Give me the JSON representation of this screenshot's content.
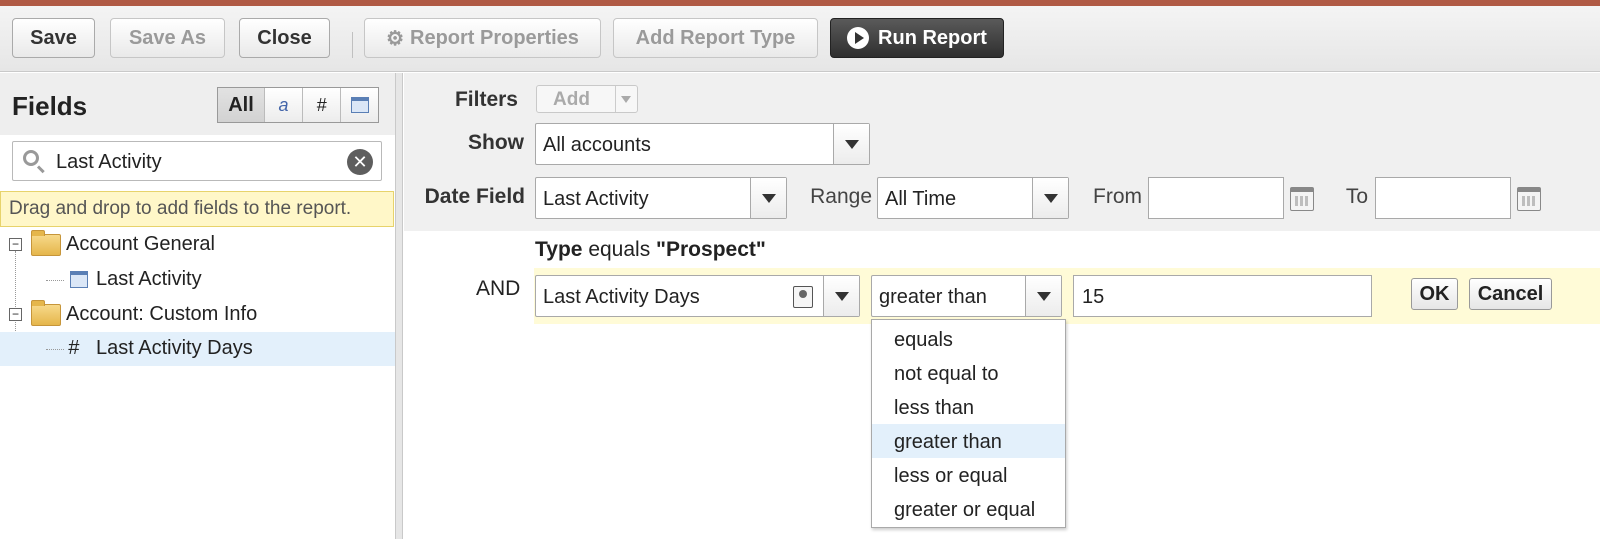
{
  "toolbar": {
    "save": "Save",
    "save_as": "Save As",
    "close": "Close",
    "report_properties": "Report Properties",
    "add_report_type": "Add Report Type",
    "run_report": "Run Report"
  },
  "fields_panel": {
    "title": "Fields",
    "type_filters": [
      "All",
      "a",
      "#",
      "calendar"
    ],
    "search_value": "Last Activity",
    "hint": "Drag and drop to add fields to the report.",
    "tree": [
      {
        "label": "Account General",
        "kind": "folder"
      },
      {
        "label": "Last Activity",
        "kind": "date"
      },
      {
        "label": "Account: Custom Info",
        "kind": "folder"
      },
      {
        "label": "Last Activity Days",
        "kind": "number",
        "selected": true
      }
    ]
  },
  "filters": {
    "filters_label": "Filters",
    "add_label": "Add",
    "show_label": "Show",
    "show_value": "All accounts",
    "date_field_label": "Date Field",
    "date_field_value": "Last Activity",
    "range_label": "Range",
    "range_value": "All Time",
    "from_label": "From",
    "from_value": "",
    "to_label": "To",
    "to_value": "",
    "existing_filter": {
      "field": "Type",
      "op": "equals",
      "value": "\"Prospect\""
    },
    "new_filter": {
      "conjunction": "AND",
      "field": "Last Activity Days",
      "operator": "greater than",
      "value": "15",
      "ok": "OK",
      "cancel": "Cancel"
    },
    "operator_options": [
      "equals",
      "not equal to",
      "less than",
      "greater than",
      "less or equal",
      "greater or equal"
    ],
    "operator_selected": "greater than"
  }
}
